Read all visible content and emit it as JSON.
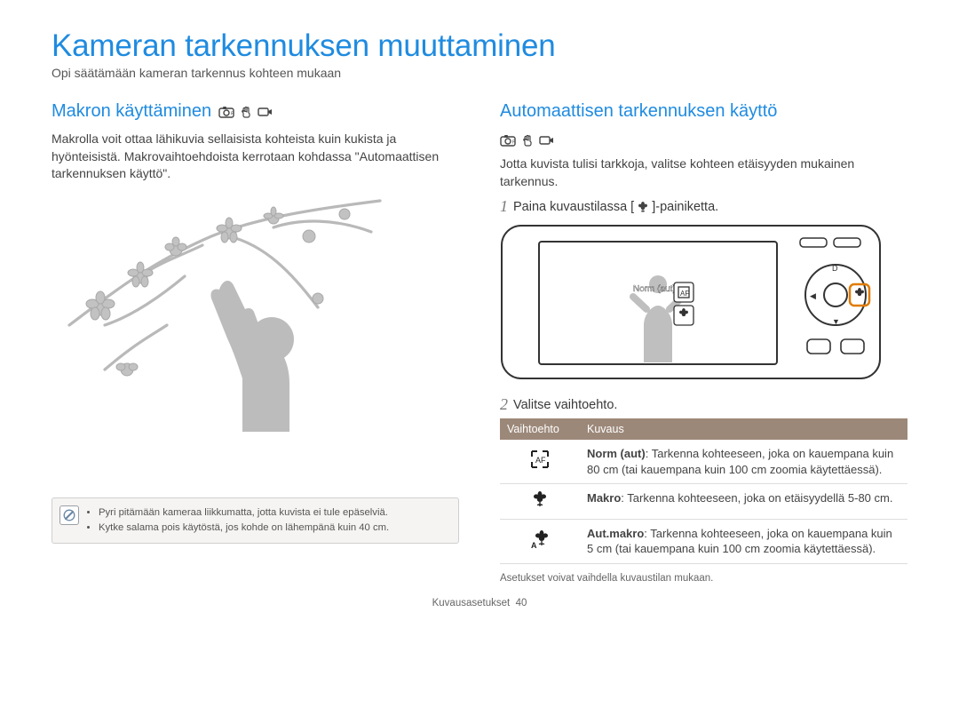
{
  "page": {
    "title": "Kameran tarkennuksen muuttaminen",
    "subtitle": "Opi säätämään kameran tarkennus kohteen mukaan",
    "footer_label": "Kuvausasetukset",
    "footer_page": "40"
  },
  "left": {
    "heading": "Makron käyttäminen",
    "body": "Makrolla voit ottaa lähikuvia sellaisista kohteista kuin kukista ja hyönteisistä. Makrovaihtoehdoista kerrotaan kohdassa \"Automaattisen tarkennuksen käyttö\".",
    "notes": [
      "Pyri pitämään kameraa liikkumatta, jotta kuvista ei tule epäselviä.",
      "Kytke salama pois käytöstä, jos kohde on lähempänä kuin 40 cm."
    ]
  },
  "right": {
    "heading": "Automaattisen tarkennuksen käyttö",
    "body": "Jotta kuvista tulisi tarkkoja, valitse kohteen etäisyyden mukainen tarkennus.",
    "step1_pre": "Paina kuvaustilassa [",
    "step1_post": "]-painiketta.",
    "step2": "Valitse vaihtoehto.",
    "camera_label": "Norm (aut)",
    "table": {
      "head_option": "Vaihtoehto",
      "head_desc": "Kuvaus",
      "rows": [
        {
          "label": "Norm (aut)",
          "desc_rest": ": Tarkenna kohteeseen, joka on kauempana kuin 80 cm (tai kauempana kuin 100 cm zoomia käytettäessä)."
        },
        {
          "label": "Makro",
          "desc_rest": ": Tarkenna kohteeseen, joka on etäisyydellä 5-80 cm."
        },
        {
          "label": "Aut.makro",
          "desc_rest": ": Tarkenna kohteeseen, joka on kauempana kuin 5 cm (tai kauempana kuin 100 cm zoomia käytettäessä)."
        }
      ]
    },
    "footnote": "Asetukset voivat vaihdella kuvaustilan mukaan."
  }
}
